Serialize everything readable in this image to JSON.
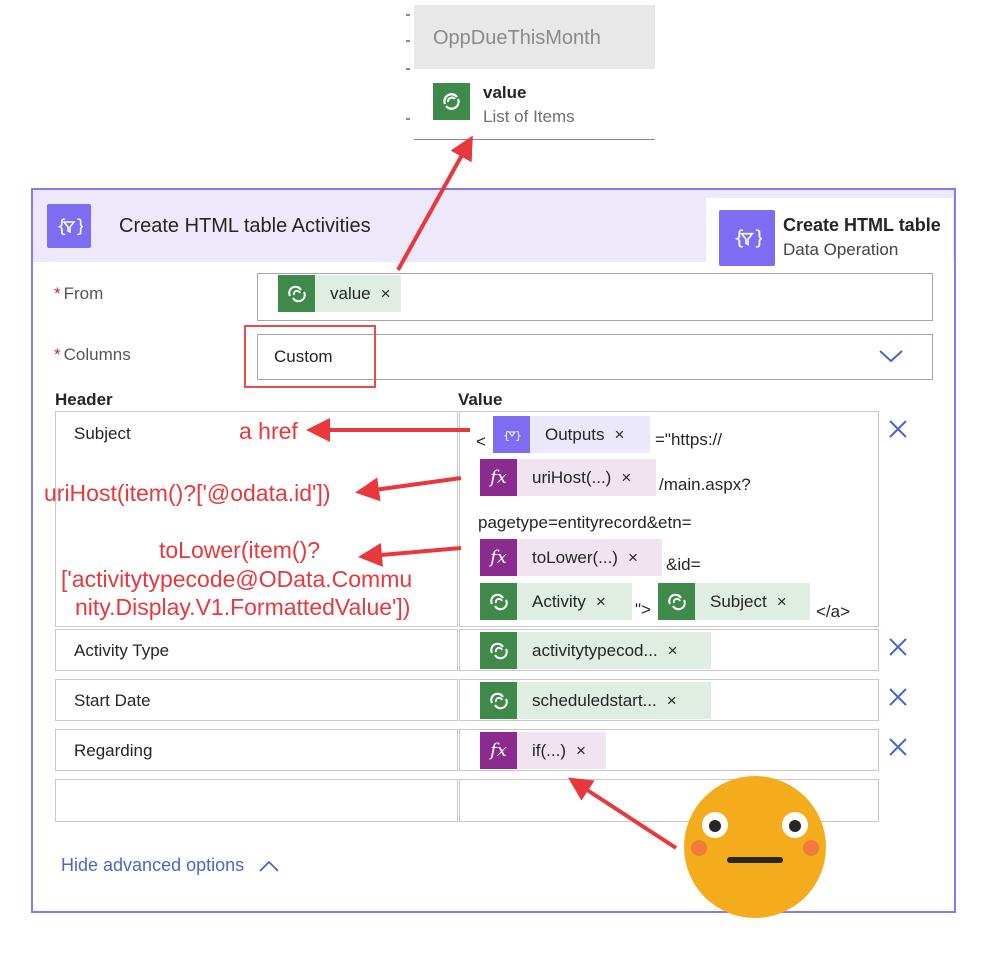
{
  "dynamic_content": {
    "group_title": "OppDueThisMonth",
    "item": {
      "icon": "dataverse-icon",
      "name": "value",
      "type": "List of Items"
    }
  },
  "action": {
    "title": "Create HTML table Activities",
    "icon": "data-operation-icon",
    "tooltip": {
      "title": "Create HTML table",
      "subtitle": "Data Operation"
    },
    "from": {
      "label": "From",
      "required_mark": "*",
      "token": {
        "icon": "dataverse-icon",
        "label": "value",
        "remove": "×"
      }
    },
    "columns": {
      "label": "Columns",
      "required_mark": "*",
      "value": "Custom"
    },
    "table": {
      "header_col": "Header",
      "value_col": "Value",
      "rows": [
        {
          "header": "Subject",
          "value": {
            "lt": "<",
            "outputs_token": "Outputs",
            "href_text": "=\"https://",
            "urihost_token": "uriHost(...)",
            "main_text": "/main.aspx?",
            "pagetype_text": "pagetype=entityrecord&etn=",
            "tolower_token": "toLower(...)",
            "id_text": "&id=",
            "activity_token": "Activity",
            "gt_text": "\">",
            "subject_token": "Subject",
            "close_text": "</a>"
          }
        },
        {
          "header": "Activity Type",
          "value": "activitytypecod..."
        },
        {
          "header": "Start Date",
          "value": "scheduledstart..."
        },
        {
          "header": "Regarding",
          "value": "if(...)"
        },
        {
          "header": "",
          "value": ""
        }
      ],
      "remove": "×"
    },
    "hide_advanced": "Hide advanced options"
  },
  "annotations": {
    "a_href": "a href",
    "urihost_expr": "uriHost(item()?['@odata.id'])",
    "tolower_line1": "toLower(item()?",
    "tolower_line2": "['activitytypecode@OData.Commu",
    "tolower_line3": "nity.Display.V1.FormattedValue'])"
  },
  "colors": {
    "card_border": "#8b77f0",
    "header_bg": "#ede9fb",
    "dataverse_green": "#3f8a4a",
    "expression_purple": "#8c2b8f",
    "operation_violet": "#7e6df2",
    "annotation_red": "#e8383d",
    "link_blue": "#4a66c9"
  }
}
